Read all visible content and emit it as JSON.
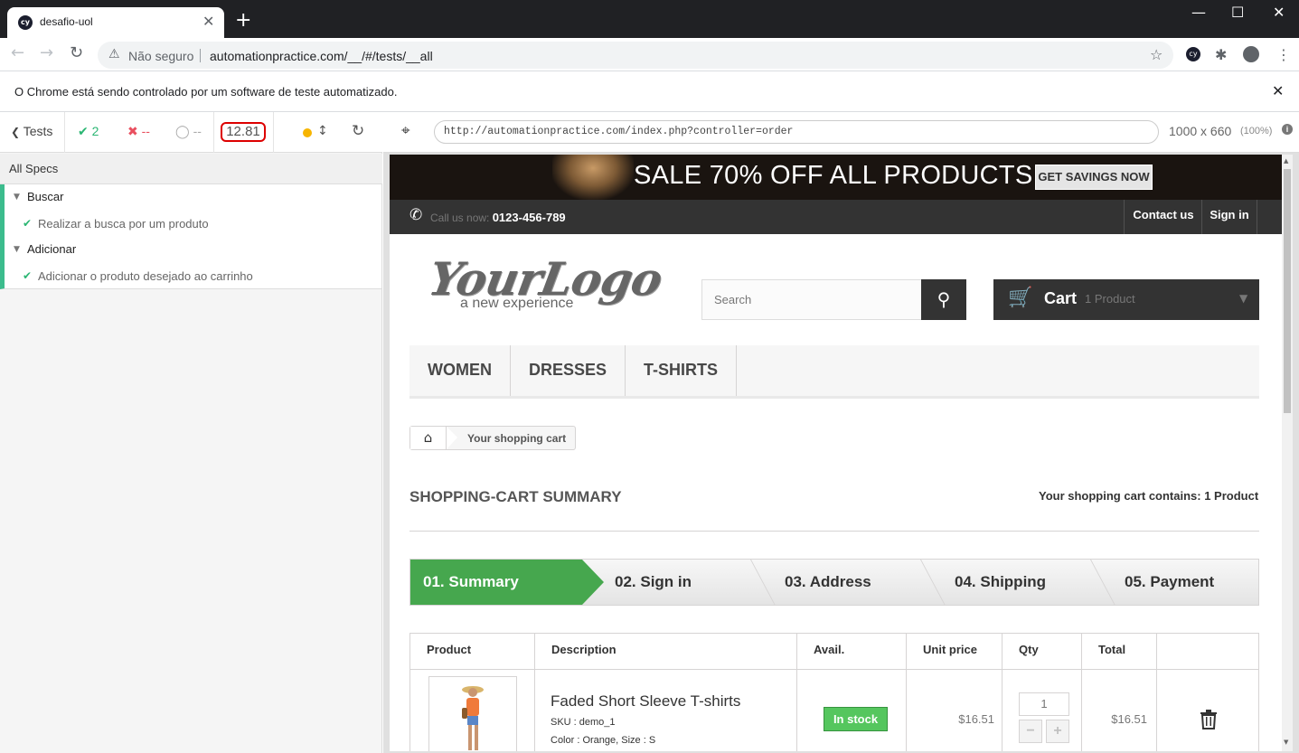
{
  "browser": {
    "tab_title": "desafio-uol",
    "tab_favicon": "cy",
    "new_tab": "+",
    "security_label": "Não seguro",
    "url": "automationpractice.com/__/#/tests/__all",
    "infobar_message": "O Chrome está sendo controlado por um software de teste automatizado."
  },
  "reporter": {
    "back_label": "Tests",
    "passed": "2",
    "failed": "--",
    "pending": "--",
    "duration": "12.81",
    "all_specs": "All Specs",
    "suites": [
      {
        "title": "Buscar",
        "test": "Realizar a busca por um produto"
      },
      {
        "title": "Adicionar",
        "test": "Adicionar o produto desejado ao carrinho"
      }
    ]
  },
  "aut": {
    "url": "http://automationpractice.com/index.php?controller=order",
    "viewport": "1000 x 660",
    "scale": "(100%)"
  },
  "site": {
    "banner_text": "SALE 70% OFF ALL PRODUCTS",
    "banner_button": "GET SAVINGS NOW",
    "call_label": "Call us now: ",
    "phone": "0123-456-789",
    "contact": "Contact us",
    "signin": "Sign in",
    "logo_main": "YourLogo",
    "logo_sub": "a new experience",
    "search_placeholder": "Search",
    "cart_label": "Cart",
    "cart_count": "1 Product",
    "menu": [
      "WOMEN",
      "DRESSES",
      "T-SHIRTS"
    ],
    "breadcrumb": "Your shopping cart",
    "heading": "SHOPPING-CART SUMMARY",
    "contains": "Your shopping cart contains: 1 Product",
    "steps": [
      "01. Summary",
      "02. Sign in",
      "03. Address",
      "04. Shipping",
      "05. Payment"
    ],
    "columns": [
      "Product",
      "Description",
      "Avail.",
      "Unit price",
      "Qty",
      "Total"
    ],
    "item": {
      "name": "Faded Short Sleeve T-shirts",
      "sku": "SKU : demo_1",
      "attributes": "Color : Orange, Size : S",
      "availability": "In stock",
      "unit_price": "$16.51",
      "qty": "1",
      "total": "$16.51"
    },
    "colors": {
      "accent_green": "#46a74e",
      "dark": "#333333"
    }
  }
}
